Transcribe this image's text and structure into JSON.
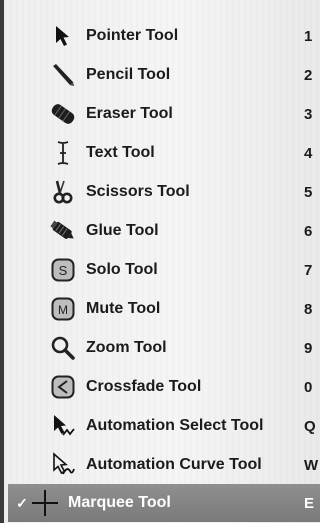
{
  "menu": {
    "items": [
      {
        "label": "Pointer Tool",
        "shortcut": "1",
        "icon": "pointer-icon"
      },
      {
        "label": "Pencil Tool",
        "shortcut": "2",
        "icon": "pencil-icon"
      },
      {
        "label": "Eraser Tool",
        "shortcut": "3",
        "icon": "eraser-icon"
      },
      {
        "label": "Text Tool",
        "shortcut": "4",
        "icon": "text-cursor-icon"
      },
      {
        "label": "Scissors Tool",
        "shortcut": "5",
        "icon": "scissors-icon"
      },
      {
        "label": "Glue Tool",
        "shortcut": "6",
        "icon": "glue-icon"
      },
      {
        "label": "Solo Tool",
        "shortcut": "7",
        "icon": "solo-icon",
        "badge": "S"
      },
      {
        "label": "Mute Tool",
        "shortcut": "8",
        "icon": "mute-icon",
        "badge": "M"
      },
      {
        "label": "Zoom Tool",
        "shortcut": "9",
        "icon": "magnifier-icon"
      },
      {
        "label": "Crossfade Tool",
        "shortcut": "0",
        "icon": "crossfade-icon"
      },
      {
        "label": "Automation Select Tool",
        "shortcut": "Q",
        "icon": "automation-select-icon"
      },
      {
        "label": "Automation Curve Tool",
        "shortcut": "W",
        "icon": "automation-curve-icon"
      },
      {
        "label": "Marquee Tool",
        "shortcut": "E",
        "icon": "crosshair-icon",
        "selected": true,
        "check": "✓"
      }
    ]
  },
  "colors": {
    "menu_background": "#f2f2f2",
    "selected_background": "#858585",
    "text": "#1b1b1b",
    "selected_text": "#ffffff"
  }
}
